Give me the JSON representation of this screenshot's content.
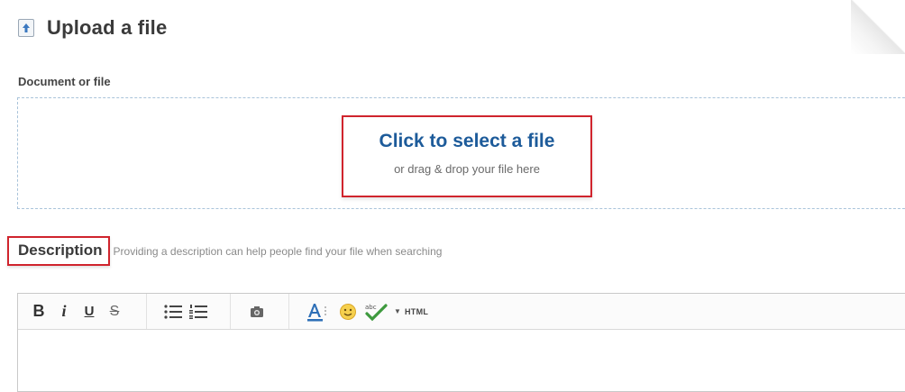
{
  "header": {
    "title": "Upload a file",
    "icon": "upload-icon"
  },
  "upload": {
    "field_label": "Document or file",
    "select_link": "Click to select a file",
    "drop_hint": "or drag & drop your file here"
  },
  "description": {
    "label": "Description",
    "hint": "Providing a description can help people find your file when searching"
  },
  "toolbar": {
    "bold": "B",
    "italic": "i",
    "underline": "U",
    "strikethrough": "S",
    "html": "HTML"
  },
  "colors": {
    "link": "#1d5b9a",
    "highlight_border": "#d0242d",
    "dropzone_border": "#a9c3da",
    "text": "#333333"
  }
}
